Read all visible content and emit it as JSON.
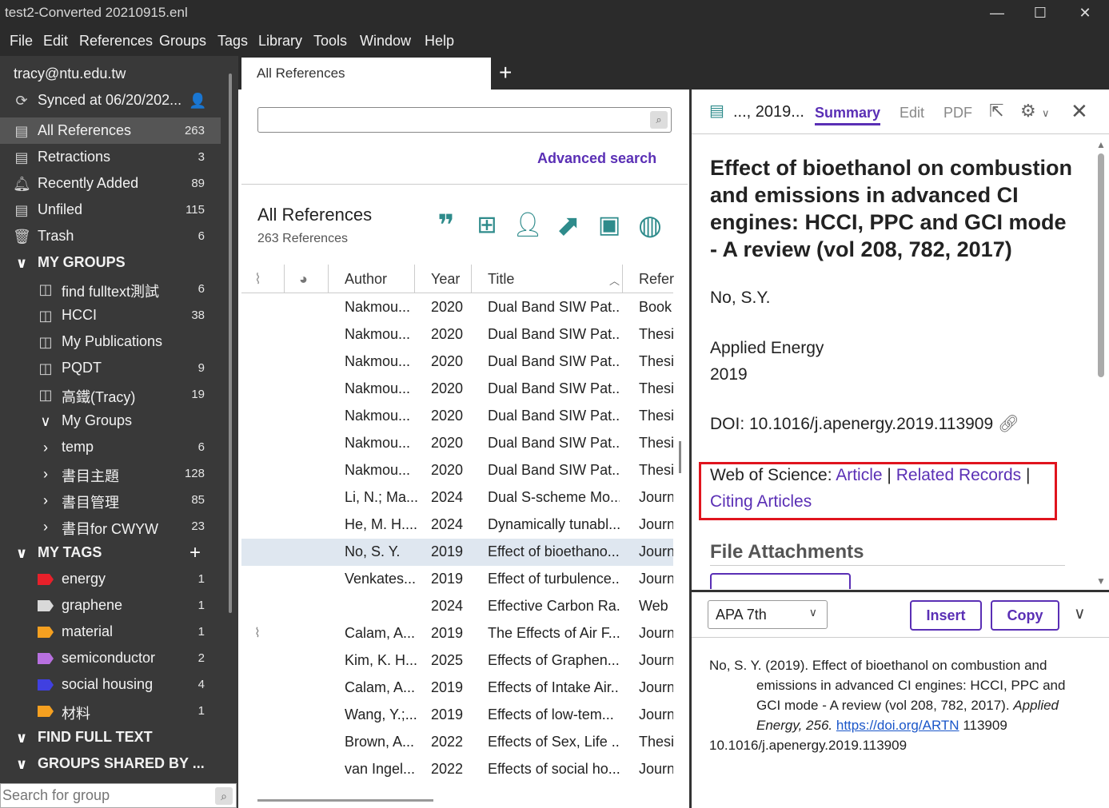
{
  "window": {
    "title": "test2-Converted 20210915.enl"
  },
  "menu": [
    "File",
    "Edit",
    "References",
    "Groups",
    "Tags",
    "Library",
    "Tools",
    "Window",
    "Help"
  ],
  "sidebar": {
    "account": "tracy@ntu.edu.tw",
    "sync": "Synced at 06/20/202...",
    "items": [
      {
        "label": "All References",
        "count": "263"
      },
      {
        "label": "Retractions",
        "count": "3"
      },
      {
        "label": "Recently Added",
        "count": "89"
      },
      {
        "label": "Unfiled",
        "count": "115"
      },
      {
        "label": "Trash",
        "count": "6"
      }
    ],
    "my_groups_header": "MY GROUPS",
    "groups": [
      {
        "label": "find fulltext測試",
        "count": "6"
      },
      {
        "label": "HCCI",
        "count": "38"
      },
      {
        "label": "My Publications",
        "count": ""
      },
      {
        "label": "PQDT",
        "count": "9"
      },
      {
        "label": "高鐵(Tracy)",
        "count": "19"
      }
    ],
    "group_sets": [
      {
        "label": "My Groups",
        "count": "",
        "expanded": true
      },
      {
        "label": "temp",
        "count": "6",
        "expanded": false
      },
      {
        "label": "書目主題",
        "count": "128",
        "expanded": false
      },
      {
        "label": "書目管理",
        "count": "85",
        "expanded": false
      },
      {
        "label": "書目for CWYW",
        "count": "23",
        "expanded": false
      }
    ],
    "my_tags_header": "MY TAGS",
    "tags": [
      {
        "label": "energy",
        "count": "1",
        "color": "#e8202a"
      },
      {
        "label": "graphene",
        "count": "1",
        "color": "#d9d9d9"
      },
      {
        "label": "material",
        "count": "1",
        "color": "#f5a020"
      },
      {
        "label": "semiconductor",
        "count": "2",
        "color": "#b870e0"
      },
      {
        "label": "social housing",
        "count": "4",
        "color": "#4040e0"
      },
      {
        "label": "材料",
        "count": "1",
        "color": "#f5a020"
      }
    ],
    "find_full_text_header": "FIND FULL TEXT",
    "groups_shared_header": "GROUPS SHARED BY ...",
    "search_placeholder": "Search for group"
  },
  "middle": {
    "tab_label": "All References",
    "advanced_search": "Advanced search",
    "library_title": "All References",
    "library_count": "263 References",
    "columns": [
      "Author",
      "Year",
      "Title",
      "Refer"
    ],
    "rows": [
      {
        "author": "Nakmou...",
        "year": "2020",
        "title": "Dual Band SIW Pat...",
        "ref": "Book",
        "att": false
      },
      {
        "author": "Nakmou...",
        "year": "2020",
        "title": "Dual Band SIW Pat...",
        "ref": "Thesi",
        "att": false
      },
      {
        "author": "Nakmou...",
        "year": "2020",
        "title": "Dual Band SIW Pat...",
        "ref": "Thesi",
        "att": false
      },
      {
        "author": "Nakmou...",
        "year": "2020",
        "title": "Dual Band SIW Pat...",
        "ref": "Thesi",
        "att": false
      },
      {
        "author": "Nakmou...",
        "year": "2020",
        "title": "Dual Band SIW Pat...",
        "ref": "Thesi",
        "att": false
      },
      {
        "author": "Nakmou...",
        "year": "2020",
        "title": "Dual Band SIW Pat...",
        "ref": "Thesi",
        "att": false
      },
      {
        "author": "Nakmou...",
        "year": "2020",
        "title": "Dual Band SIW Pat...",
        "ref": "Thesi",
        "att": false
      },
      {
        "author": "Li, N.; Ma...",
        "year": "2024",
        "title": "Dual S-scheme Mo...",
        "ref": "Journ",
        "att": false
      },
      {
        "author": "He, M. H....",
        "year": "2024",
        "title": "Dynamically tunabl...",
        "ref": "Journ",
        "att": false
      },
      {
        "author": "No, S. Y.",
        "year": "2019",
        "title": "Effect of bioethano...",
        "ref": "Journ",
        "att": false,
        "selected": true
      },
      {
        "author": "Venkates...",
        "year": "2019",
        "title": "Effect of turbulence...",
        "ref": "Journ",
        "att": false
      },
      {
        "author": "",
        "year": "2024",
        "title": "Effective Carbon Ra...",
        "ref": "Web",
        "att": false
      },
      {
        "author": "Calam, A...",
        "year": "2019",
        "title": "The Effects of Air F...",
        "ref": "Journ",
        "att": true
      },
      {
        "author": "Kim, K. H...",
        "year": "2025",
        "title": "Effects of Graphen...",
        "ref": "Journ",
        "att": false
      },
      {
        "author": "Calam, A...",
        "year": "2019",
        "title": "Effects of Intake Air...",
        "ref": "Journ",
        "att": false
      },
      {
        "author": "Wang, Y.;...",
        "year": "2019",
        "title": "Effects of low-tem...",
        "ref": "Journ",
        "att": false
      },
      {
        "author": "Brown, A...",
        "year": "2022",
        "title": "Effects of Sex, Life ...",
        "ref": "Thesi",
        "att": false
      },
      {
        "author": "van Ingel...",
        "year": "2022",
        "title": "Effects of social ho...",
        "ref": "Journ",
        "att": false
      }
    ]
  },
  "detail": {
    "short_ref": "..., 2019...",
    "tabs": [
      "Summary",
      "Edit",
      "PDF"
    ],
    "title": "Effect of bioethanol on combustion and emissions in advanced CI engines: HCCI, PPC and GCI mode - A review (vol 208, 782, 2017)",
    "author": "No, S.Y.",
    "journal": "Applied Energy",
    "year": "2019",
    "doi": "DOI: 10.1016/j.apenergy.2019.113909",
    "wos_label": "Web of Science:",
    "wos_article": "Article",
    "wos_sep": "|",
    "wos_related": "Related Records",
    "wos_citing": "Citing Articles",
    "file_attachments": "File Attachments",
    "citation_style": "APA 7th",
    "insert_label": "Insert",
    "copy_label": "Copy",
    "citation_part1": "No, S. Y. (2019). Effect of bioethanol on combustion and emissions in advanced CI engines: HCCI, PPC and GCI mode - A review (vol 208, 782, 2017).",
    "citation_journal": "Applied Energy, 256.",
    "citation_url": "https://doi.org/ARTN",
    "citation_tail": "113909",
    "citation_doi": "10.1016/j.apenergy.2019.113909"
  }
}
